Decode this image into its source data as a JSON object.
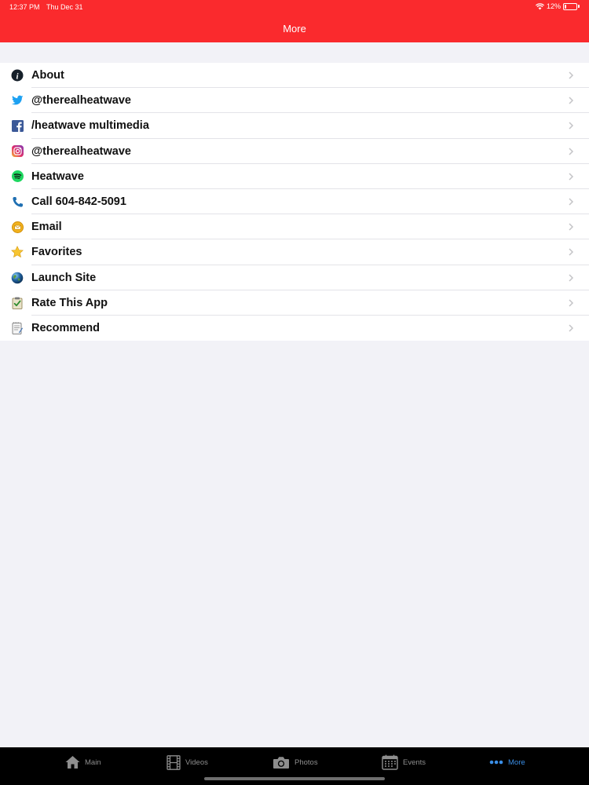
{
  "status_bar": {
    "time": "12:37 PM",
    "date": "Thu Dec 31",
    "battery": "12%",
    "battery_level": 0.12
  },
  "nav": {
    "title": "More"
  },
  "list": {
    "items": [
      {
        "label": "About",
        "icon": "info-icon"
      },
      {
        "label": "@therealheatwave",
        "icon": "twitter-icon"
      },
      {
        "label": "/heatwave multimedia",
        "icon": "facebook-icon"
      },
      {
        "label": "@therealheatwave",
        "icon": "instagram-icon"
      },
      {
        "label": "Heatwave",
        "icon": "spotify-icon"
      },
      {
        "label": "Call 604-842-5091",
        "icon": "phone-icon"
      },
      {
        "label": "Email",
        "icon": "email-icon"
      },
      {
        "label": "Favorites",
        "icon": "star-icon"
      },
      {
        "label": "Launch Site",
        "icon": "globe-icon"
      },
      {
        "label": "Rate This App",
        "icon": "clipboard-check-icon"
      },
      {
        "label": "Recommend",
        "icon": "notepad-icon"
      }
    ]
  },
  "tabbar": {
    "tabs": [
      {
        "label": "Main",
        "icon": "home-icon",
        "active": false
      },
      {
        "label": "Videos",
        "icon": "film-icon",
        "active": false
      },
      {
        "label": "Photos",
        "icon": "camera-icon",
        "active": false
      },
      {
        "label": "Events",
        "icon": "calendar-icon",
        "active": false
      },
      {
        "label": "More",
        "icon": "more-dots-icon",
        "active": true
      }
    ]
  },
  "colors": {
    "header": "#fa2a2d",
    "active_tab": "#3a8ee6",
    "inactive_tab": "#8e8e8e",
    "background": "#f2f2f7"
  }
}
